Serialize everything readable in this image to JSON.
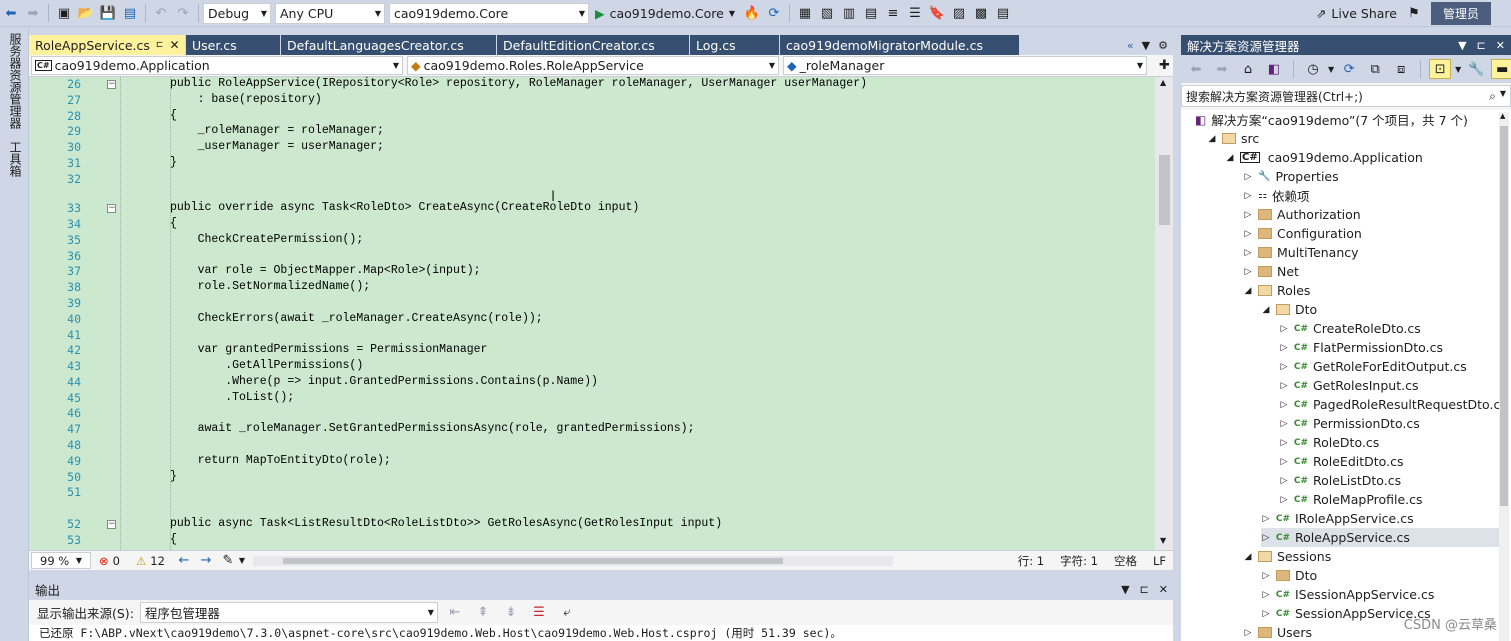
{
  "toolbar": {
    "config": "Debug",
    "platform": "Any CPU",
    "startup_project": "cao919demo.Core",
    "run_target": "cao919demo.Core",
    "live_share": "Live Share",
    "admin": "管理员"
  },
  "sidebar": {
    "item1": "服务器资源管理器",
    "item2": "工具箱"
  },
  "tabs": [
    {
      "label": "RoleAppService.cs",
      "active": true
    },
    {
      "label": "User.cs"
    },
    {
      "label": "DefaultLanguagesCreator.cs"
    },
    {
      "label": "DefaultEditionCreator.cs"
    },
    {
      "label": "Log.cs"
    },
    {
      "label": "cao919demoMigratorModule.cs"
    }
  ],
  "navbar": {
    "project": "cao919demo.Application",
    "class": "cao919demo.Roles.RoleAppService",
    "member": "_roleManager"
  },
  "code_lines": [
    {
      "n": "26",
      "t": "public RoleAppService(IRepository<Role> repository, RoleManager roleManager, UserManager userManager)"
    },
    {
      "n": "27",
      "t": "    : base(repository)"
    },
    {
      "n": "28",
      "t": "{"
    },
    {
      "n": "29",
      "t": "    _roleManager = roleManager;"
    },
    {
      "n": "30",
      "t": "    _userManager = userManager;"
    },
    {
      "n": "31",
      "t": "}"
    },
    {
      "n": "32",
      "t": ""
    },
    {
      "n": "33",
      "t": "public override async Task<RoleDto> CreateAsync(CreateRoleDto input)"
    },
    {
      "n": "34",
      "t": "{"
    },
    {
      "n": "35",
      "t": "    CheckCreatePermission();"
    },
    {
      "n": "36",
      "t": ""
    },
    {
      "n": "37",
      "t": "    var role = ObjectMapper.Map<Role>(input);"
    },
    {
      "n": "38",
      "t": "    role.SetNormalizedName();"
    },
    {
      "n": "39",
      "t": ""
    },
    {
      "n": "40",
      "t": "    CheckErrors(await _roleManager.CreateAsync(role));"
    },
    {
      "n": "41",
      "t": ""
    },
    {
      "n": "42",
      "t": "    var grantedPermissions = PermissionManager"
    },
    {
      "n": "43",
      "t": "        .GetAllPermissions()"
    },
    {
      "n": "44",
      "t": "        .Where(p => input.GrantedPermissions.Contains(p.Name))"
    },
    {
      "n": "45",
      "t": "        .ToList();"
    },
    {
      "n": "46",
      "t": ""
    },
    {
      "n": "47",
      "t": "    await _roleManager.SetGrantedPermissionsAsync(role, grantedPermissions);"
    },
    {
      "n": "48",
      "t": ""
    },
    {
      "n": "49",
      "t": "    return MapToEntityDto(role);"
    },
    {
      "n": "50",
      "t": "}"
    },
    {
      "n": "51",
      "t": ""
    },
    {
      "n": "52",
      "t": "public async Task<ListResultDto<RoleListDto>> GetRolesAsync(GetRolesInput input)"
    },
    {
      "n": "53",
      "t": "{"
    }
  ],
  "status": {
    "zoom": "99 %",
    "errors": "0",
    "warnings": "12",
    "line": "行: 1",
    "char": "字符: 1",
    "spaces": "空格",
    "eol": "LF"
  },
  "output": {
    "title": "输出",
    "source_label": "显示输出来源(S):",
    "source_value": "程序包管理器",
    "text": "已还原 F:\\ABP.vNext\\cao919demo\\7.3.0\\aspnet-core\\src\\cao919demo.Web.Host\\cao919demo.Web.Host.csproj (用时 51.39 sec)。"
  },
  "solution": {
    "title": "解决方案资源管理器",
    "search_placeholder": "搜索解决方案资源管理器(Ctrl+;)",
    "root": "解决方案“cao919demo”(7 个项目，共 7 个)",
    "items": [
      {
        "label": "src",
        "depth": 1,
        "type": "folder-open",
        "exp": "open"
      },
      {
        "label": "cao919demo.Application",
        "depth": 2,
        "type": "project",
        "exp": "open"
      },
      {
        "label": "Properties",
        "depth": 3,
        "type": "props",
        "exp": "closed"
      },
      {
        "label": "依赖项",
        "depth": 3,
        "type": "deps",
        "exp": "closed"
      },
      {
        "label": "Authorization",
        "depth": 3,
        "type": "folder",
        "exp": "closed"
      },
      {
        "label": "Configuration",
        "depth": 3,
        "type": "folder",
        "exp": "closed"
      },
      {
        "label": "MultiTenancy",
        "depth": 3,
        "type": "folder",
        "exp": "closed"
      },
      {
        "label": "Net",
        "depth": 3,
        "type": "folder",
        "exp": "closed"
      },
      {
        "label": "Roles",
        "depth": 3,
        "type": "folder-open",
        "exp": "open"
      },
      {
        "label": "Dto",
        "depth": 4,
        "type": "folder-open",
        "exp": "open"
      },
      {
        "label": "CreateRoleDto.cs",
        "depth": 5,
        "type": "cs",
        "exp": "closed"
      },
      {
        "label": "FlatPermissionDto.cs",
        "depth": 5,
        "type": "cs",
        "exp": "closed"
      },
      {
        "label": "GetRoleForEditOutput.cs",
        "depth": 5,
        "type": "cs",
        "exp": "closed"
      },
      {
        "label": "GetRolesInput.cs",
        "depth": 5,
        "type": "cs",
        "exp": "closed"
      },
      {
        "label": "PagedRoleResultRequestDto.cs",
        "depth": 5,
        "type": "cs",
        "exp": "closed"
      },
      {
        "label": "PermissionDto.cs",
        "depth": 5,
        "type": "cs",
        "exp": "closed"
      },
      {
        "label": "RoleDto.cs",
        "depth": 5,
        "type": "cs",
        "exp": "closed"
      },
      {
        "label": "RoleEditDto.cs",
        "depth": 5,
        "type": "cs",
        "exp": "closed"
      },
      {
        "label": "RoleListDto.cs",
        "depth": 5,
        "type": "cs",
        "exp": "closed"
      },
      {
        "label": "RoleMapProfile.cs",
        "depth": 5,
        "type": "cs",
        "exp": "closed"
      },
      {
        "label": "IRoleAppService.cs",
        "depth": 4,
        "type": "cs",
        "exp": "closed"
      },
      {
        "label": "RoleAppService.cs",
        "depth": 4,
        "type": "cs",
        "exp": "closed",
        "selected": true
      },
      {
        "label": "Sessions",
        "depth": 3,
        "type": "folder-open",
        "exp": "open"
      },
      {
        "label": "Dto",
        "depth": 4,
        "type": "folder",
        "exp": "closed"
      },
      {
        "label": "ISessionAppService.cs",
        "depth": 4,
        "type": "cs",
        "exp": "closed"
      },
      {
        "label": "SessionAppService.cs",
        "depth": 4,
        "type": "cs",
        "exp": "closed"
      },
      {
        "label": "Users",
        "depth": 3,
        "type": "folder",
        "exp": "closed"
      }
    ]
  },
  "watermark": "CSDN @云草桑"
}
